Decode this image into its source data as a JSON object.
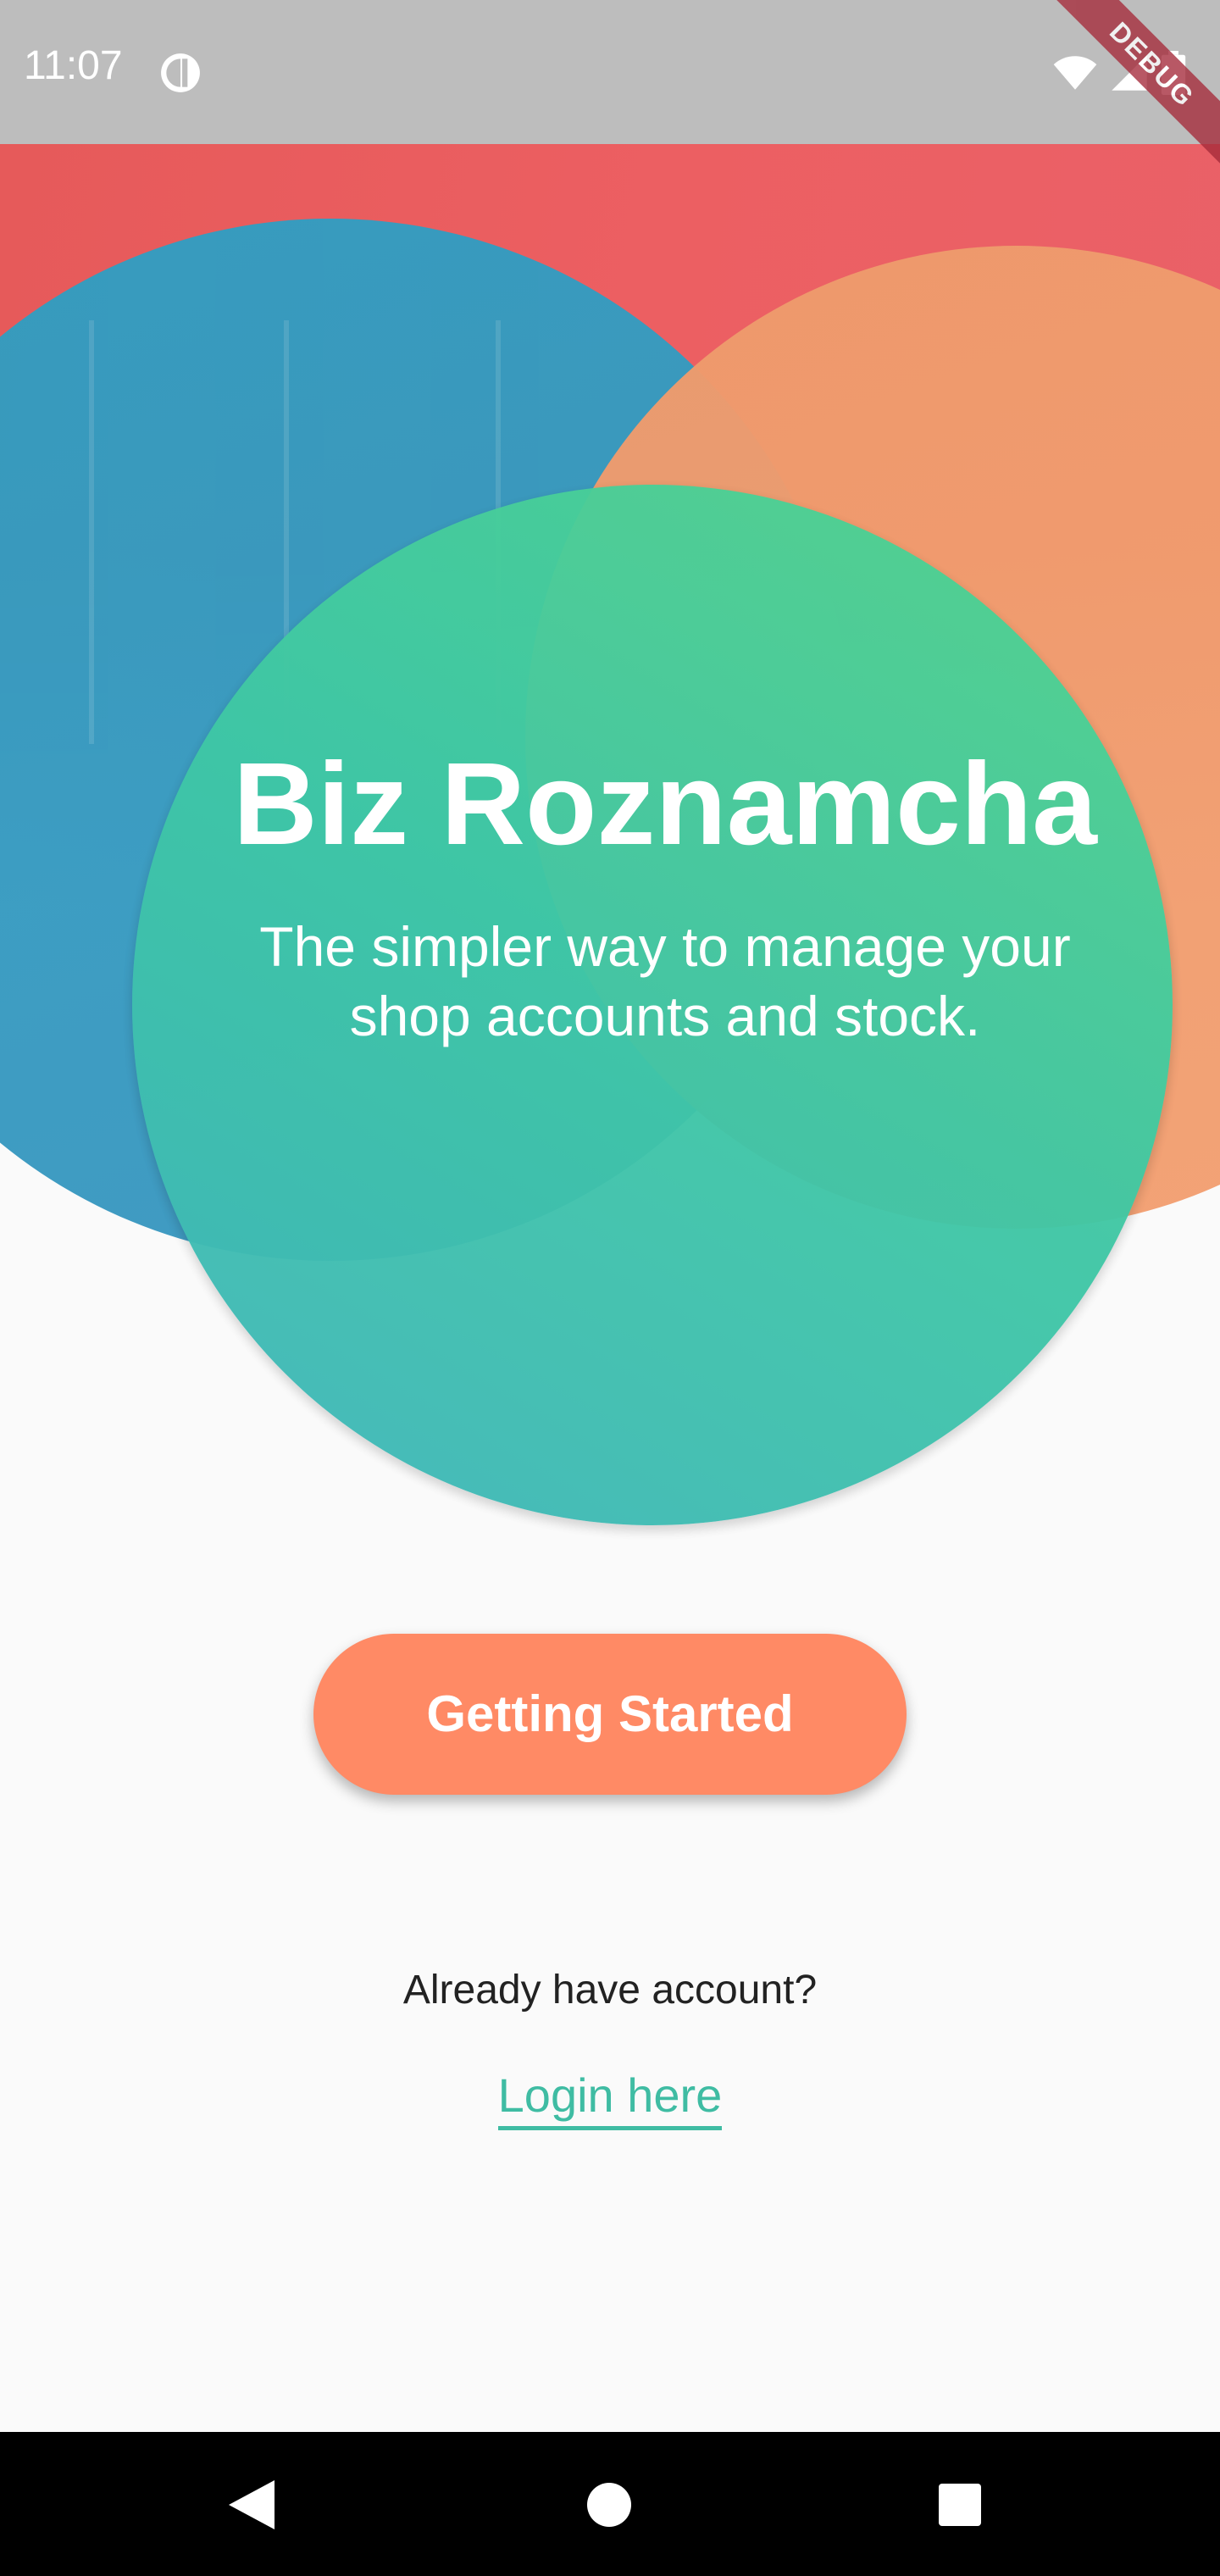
{
  "status_bar": {
    "time": "11:07",
    "app_icon": "pie-chart-icon",
    "icons": [
      "wifi-icon",
      "cell-signal-icon",
      "battery-icon"
    ]
  },
  "debug_banner": "DEBUG",
  "hero": {
    "title": "Biz Roznamcha",
    "subtitle": "The simpler way to manage your shop accounts and stock.",
    "colors": {
      "background_band": "#ec5f62",
      "circle_blue": "#2f9fc2",
      "circle_orange": "#f0a070",
      "circle_green": "#45c8a8"
    }
  },
  "actions": {
    "get_started_label": "Getting Started",
    "already_account_text": "Already have account?",
    "login_link_label": "Login here",
    "button_color": "#ff8a65",
    "link_color": "#3fbca3"
  },
  "nav_bar": {
    "buttons": [
      "back-icon",
      "home-icon",
      "recents-icon"
    ]
  }
}
